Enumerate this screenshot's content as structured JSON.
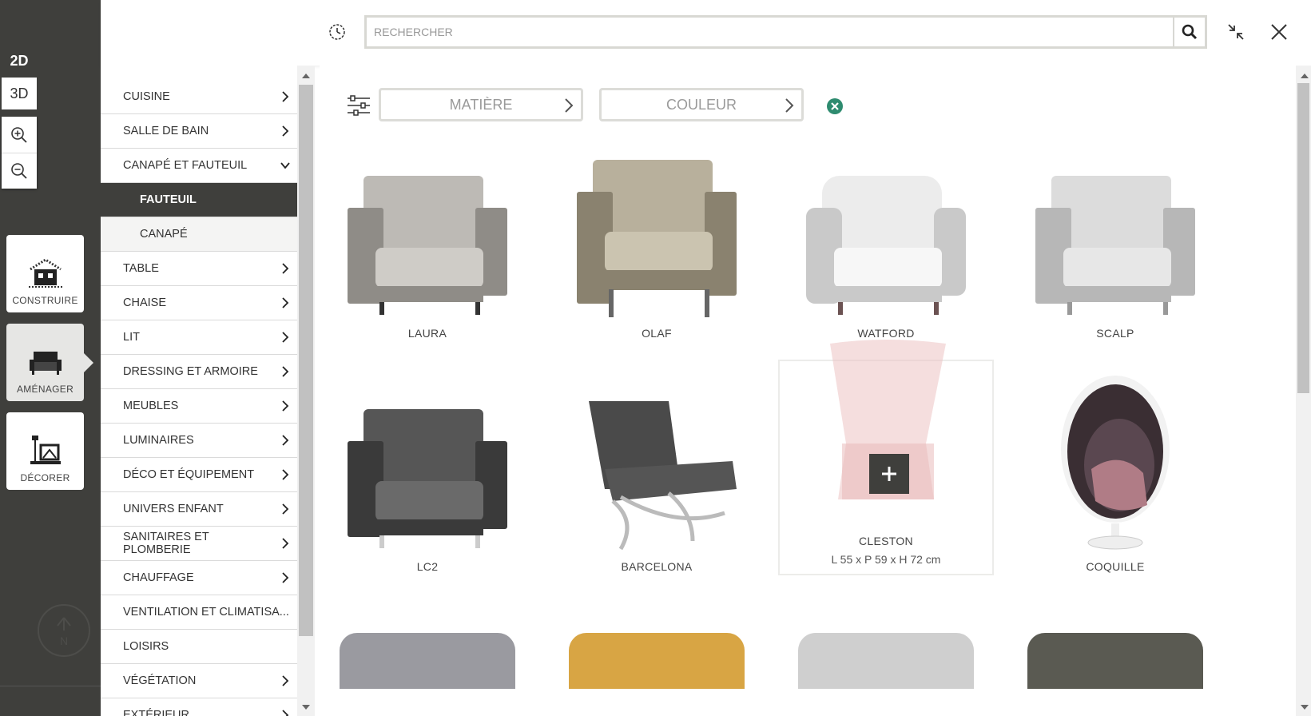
{
  "view_toggle": {
    "two_d": "2D",
    "three_d": "3D",
    "active": "2D"
  },
  "zoom": {
    "zoom_in_icon": "zoom-in-icon",
    "zoom_out_icon": "zoom-out-icon"
  },
  "modes": [
    {
      "label": "CONSTRUIRE",
      "icon": "house-icon"
    },
    {
      "label": "AMÉNAGER",
      "icon": "sofa-icon",
      "active": true
    },
    {
      "label": "DÉCORER",
      "icon": "lamp-frame-icon"
    }
  ],
  "compass": {
    "label": "N"
  },
  "search": {
    "placeholder": "RECHERCHER",
    "value": ""
  },
  "categories": [
    {
      "label": "CUISINE",
      "chevron": "right"
    },
    {
      "label": "SALLE DE BAIN",
      "chevron": "right"
    },
    {
      "label": "CANAPÉ ET FAUTEUIL",
      "chevron": "down"
    },
    {
      "label": "FAUTEUIL",
      "sub": true,
      "active": true
    },
    {
      "label": "CANAPÉ",
      "sub": true
    },
    {
      "label": "TABLE",
      "chevron": "right"
    },
    {
      "label": "CHAISE",
      "chevron": "right"
    },
    {
      "label": "LIT",
      "chevron": "right"
    },
    {
      "label": "DRESSING ET ARMOIRE",
      "chevron": "right"
    },
    {
      "label": "MEUBLES",
      "chevron": "right"
    },
    {
      "label": "LUMINAIRES",
      "chevron": "right"
    },
    {
      "label": "DÉCO ET ÉQUIPEMENT",
      "chevron": "right"
    },
    {
      "label": "UNIVERS ENFANT",
      "chevron": "right"
    },
    {
      "label": "SANITAIRES ET PLOMBERIE",
      "chevron": "right"
    },
    {
      "label": "CHAUFFAGE",
      "chevron": "right"
    },
    {
      "label": "VENTILATION ET CLIMATISA...",
      "chevron": ""
    },
    {
      "label": "LOISIRS",
      "chevron": ""
    },
    {
      "label": "VÉGÉTATION",
      "chevron": "right"
    },
    {
      "label": "EXTÉRIEUR",
      "chevron": "right"
    }
  ],
  "filters": {
    "matiere": "MATIÈRE",
    "couleur": "COULEUR"
  },
  "products": [
    {
      "name": "LAURA"
    },
    {
      "name": "OLAF"
    },
    {
      "name": "WATFORD"
    },
    {
      "name": "SCALP"
    },
    {
      "name": "LC2"
    },
    {
      "name": "BARCELONA"
    },
    {
      "name": "CLESTON",
      "dimensions": "L 55 x P 59 x H 72 cm",
      "hovered": true
    },
    {
      "name": "COQUILLE"
    }
  ],
  "colors": {
    "rail": "#3f3f3c",
    "accent_clear": "#2e8b6f"
  }
}
